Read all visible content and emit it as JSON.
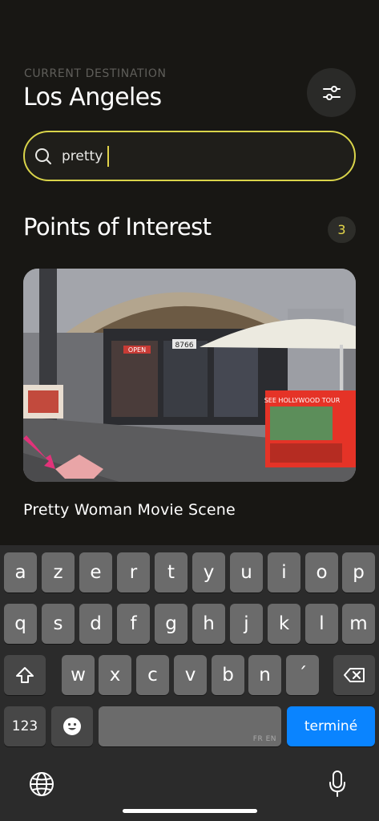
{
  "header": {
    "destination_label": "CURRENT DESTINATION",
    "destination_city": "Los Angeles",
    "filter_icon": "sliders-icon"
  },
  "search": {
    "value": "pretty",
    "icon": "search-icon",
    "border_color": "#d9d44a"
  },
  "section": {
    "title": "Points of Interest",
    "count": "3",
    "count_color": "#e6d84a"
  },
  "card": {
    "title": "Pretty Woman Movie Scene",
    "image_signs": {
      "open": "OPEN",
      "address": "8766",
      "tour": "SEE HOLLYWOOD TOUR"
    }
  },
  "keyboard": {
    "row1": [
      "a",
      "z",
      "e",
      "r",
      "t",
      "y",
      "u",
      "i",
      "o",
      "p"
    ],
    "row2": [
      "q",
      "s",
      "d",
      "f",
      "g",
      "h",
      "j",
      "k",
      "l",
      "m"
    ],
    "row3": [
      "w",
      "x",
      "c",
      "v",
      "b",
      "n",
      "´"
    ],
    "numbers_label": "123",
    "space_hint": "FR EN",
    "done_label": "terminé",
    "emoji_icon": "emoji-icon",
    "shift_icon": "shift-icon",
    "delete_icon": "delete-icon",
    "globe_icon": "globe-icon",
    "mic_icon": "microphone-icon",
    "accent_color": "#0a84ff"
  }
}
